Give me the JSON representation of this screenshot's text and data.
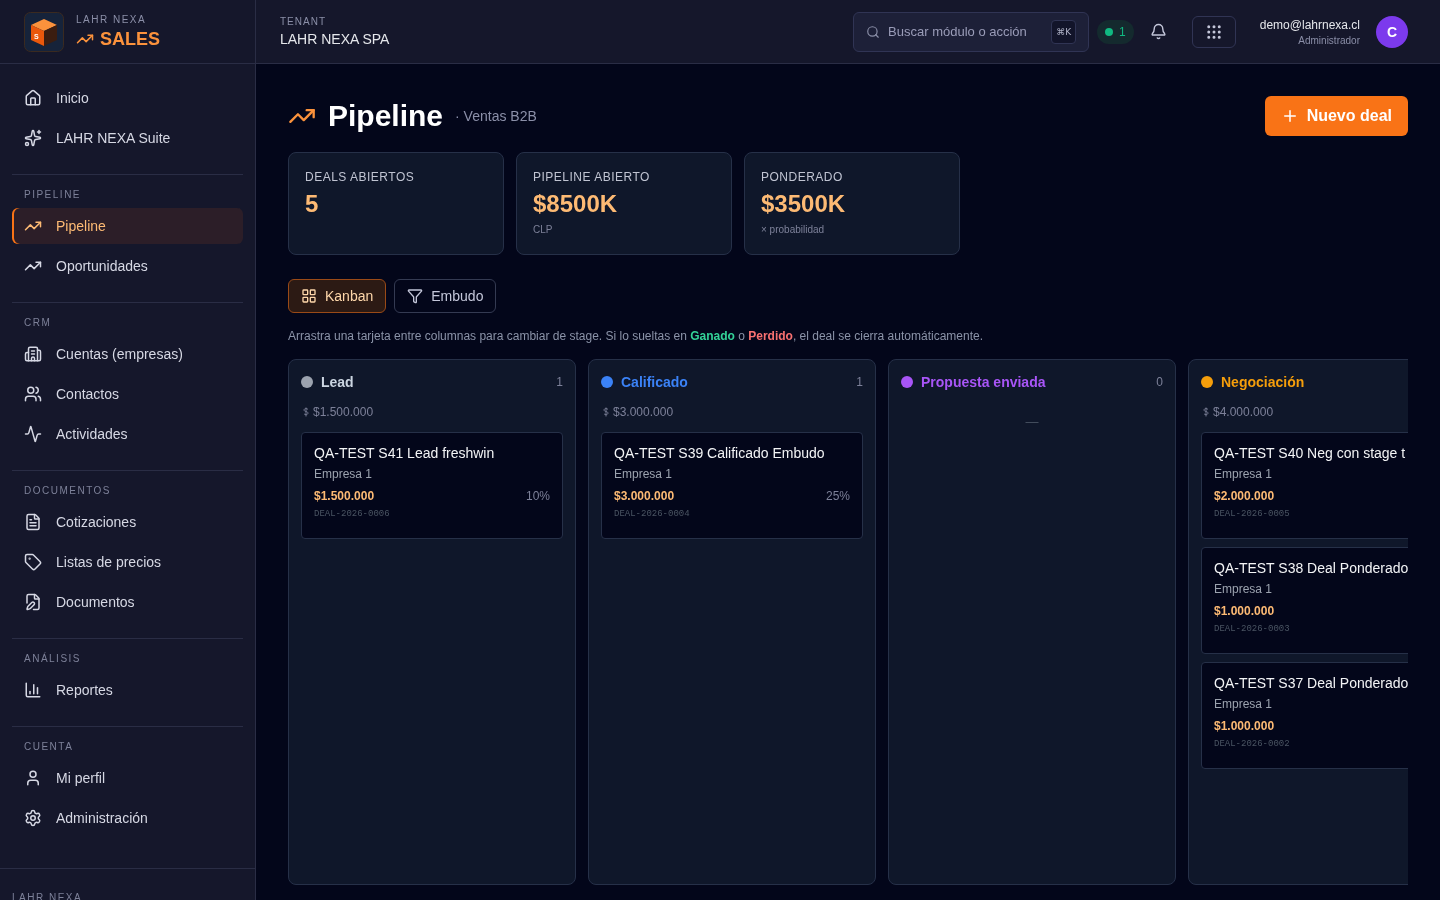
{
  "brand": {
    "company": "LAHR NEXA",
    "product": "SALES",
    "logo_letter": "S"
  },
  "sidebar": {
    "top_items": [
      {
        "label": "Inicio",
        "selected": false
      },
      {
        "label": "LAHR NEXA Suite",
        "selected": false
      }
    ],
    "sections": [
      {
        "title": "PIPELINE",
        "items": [
          {
            "label": "Pipeline",
            "selected": true
          },
          {
            "label": "Oportunidades",
            "selected": false
          }
        ]
      },
      {
        "title": "CRM",
        "items": [
          {
            "label": "Cuentas (empresas)",
            "selected": false
          },
          {
            "label": "Contactos",
            "selected": false
          },
          {
            "label": "Actividades",
            "selected": false
          }
        ]
      },
      {
        "title": "DOCUMENTOS",
        "items": [
          {
            "label": "Cotizaciones",
            "selected": false
          },
          {
            "label": "Listas de precios",
            "selected": false
          },
          {
            "label": "Documentos",
            "selected": false
          }
        ]
      },
      {
        "title": "ANÁLISIS",
        "items": [
          {
            "label": "Reportes",
            "selected": false
          }
        ]
      },
      {
        "title": "CUENTA",
        "items": [
          {
            "label": "Mi perfil",
            "selected": false
          },
          {
            "label": "Administración",
            "selected": false
          }
        ]
      }
    ],
    "footer": "LAHR NEXA"
  },
  "topbar": {
    "tenant_label": "TENANT",
    "tenant": "LAHR NEXA SPA",
    "search": {
      "placeholder": "Buscar módulo o acción",
      "shortcut": "⌘K"
    },
    "status_count": "1",
    "user": {
      "email": "demo@lahrnexa.cl",
      "role": "Administrador",
      "initial": "C"
    }
  },
  "page": {
    "title": "Pipeline",
    "subtitle": "· Ventas B2B",
    "new_button": "Nuevo deal"
  },
  "stats": [
    {
      "label": "DEALS ABIERTOS",
      "value": "5"
    },
    {
      "label": "PIPELINE ABIERTO",
      "value": "$8500K",
      "note": "CLP"
    },
    {
      "label": "PONDERADO",
      "value": "$3500K",
      "note": "× probabilidad"
    }
  ],
  "views": [
    {
      "label": "Kanban",
      "selected": true
    },
    {
      "label": "Embudo",
      "selected": false
    }
  ],
  "hint": [
    {
      "kind": "plain",
      "text": "Arrastra una tarjeta entre columnas para cambiar de stage. Si lo sueltas en "
    },
    {
      "kind": "won",
      "text": "Ganado"
    },
    {
      "kind": "plain",
      "text": " o "
    },
    {
      "kind": "lost",
      "text": "Perdido"
    },
    {
      "kind": "plain",
      "text": ", el deal se cierra automáticamente."
    }
  ],
  "columns": [
    {
      "name": "Lead",
      "color": "#9ca3af",
      "count": "1",
      "total": "$1.500.000",
      "deals": [
        {
          "title": "QA-TEST S41 Lead freshwin",
          "company": "Empresa 1",
          "amount": "$1.500.000",
          "probability": "10%",
          "code": "DEAL-2026-0006"
        }
      ]
    },
    {
      "name": "Calificado",
      "color": "#3b82f6",
      "count": "1",
      "total": "$3.000.000",
      "deals": [
        {
          "title": "QA-TEST S39 Calificado Embudo",
          "company": "Empresa 1",
          "amount": "$3.000.000",
          "probability": "25%",
          "code": "DEAL-2026-0004"
        }
      ]
    },
    {
      "name": "Propuesta enviada",
      "color": "#a855f7",
      "count": "0",
      "empty": "—"
    },
    {
      "name": "Negociación",
      "color": "#f59e0b",
      "total": "$4.000.000",
      "deals": [
        {
          "title": "QA-TEST S40 Neg con stage t",
          "company": "Empresa 1",
          "amount": "$2.000.000",
          "code": "DEAL-2026-0005"
        },
        {
          "title": "QA-TEST S38 Deal Ponderado",
          "company": "Empresa 1",
          "amount": "$1.000.000",
          "code": "DEAL-2026-0003"
        },
        {
          "title": "QA-TEST S37 Deal Ponderado",
          "company": "Empresa 1",
          "amount": "$1.000.000",
          "code": "DEAL-2026-0002"
        }
      ]
    }
  ]
}
